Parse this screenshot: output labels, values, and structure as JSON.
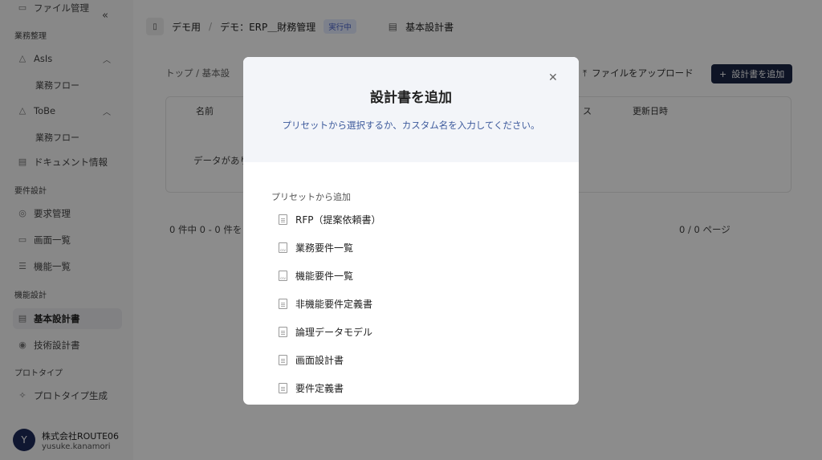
{
  "sidebar": {
    "file_mgmt": "ファイル管理",
    "section_gyomu": "業務整理",
    "asis": "AsIs",
    "asis_flow": "業務フロー",
    "tobe": "ToBe",
    "tobe_flow": "業務フロー",
    "document_info": "ドキュメント情報",
    "section_req": "要件設計",
    "req_mgmt": "要求管理",
    "screen_list": "画面一覧",
    "func_list": "機能一覧",
    "section_func": "機能設計",
    "basic_design": "基本設計書",
    "tech_design": "技術設計書",
    "section_proto": "プロトタイプ",
    "proto_gen": "プロトタイプ生成",
    "user_initial": "Y",
    "user_company": "株式会社ROUTE06",
    "user_email": "yusuke.kanamori"
  },
  "topbar": {
    "project": "デモ用",
    "separator": "/",
    "subproject": "デモ：ERP＿財務管理",
    "status": "実行中",
    "doc": "基本設計書"
  },
  "main": {
    "breadcrumb": "トップ / 基本設",
    "upload": "ファイルをアップロード",
    "add_design": "設計書を追加",
    "col_name": "名前",
    "col_status": "ス",
    "col_updated": "更新日時",
    "empty": "データがあり",
    "pagination_left": "0 件中 0 - 0 件を",
    "pagination_right": "0 / 0 ページ"
  },
  "modal": {
    "title": "設計書を追加",
    "subtitle": "プリセットから選択するか、カスタム名を入力してください。",
    "preset_label": "プリセットから追加",
    "presets": [
      {
        "label": "RFP（提案依頼書）",
        "icon": "document-icon"
      },
      {
        "label": "業務要件一覧",
        "icon": "csv-icon"
      },
      {
        "label": "機能要件一覧",
        "icon": "csv-icon"
      },
      {
        "label": "非機能要件定義書",
        "icon": "document-icon"
      },
      {
        "label": "論理データモデル",
        "icon": "document-icon"
      },
      {
        "label": "画面設計書",
        "icon": "document-icon"
      },
      {
        "label": "要件定義書",
        "icon": "document-icon"
      }
    ]
  },
  "colors": {
    "accent": "#1b2544",
    "subtitle": "#3d5a9c",
    "overlay": "rgba(0,0,0,0.45)"
  }
}
